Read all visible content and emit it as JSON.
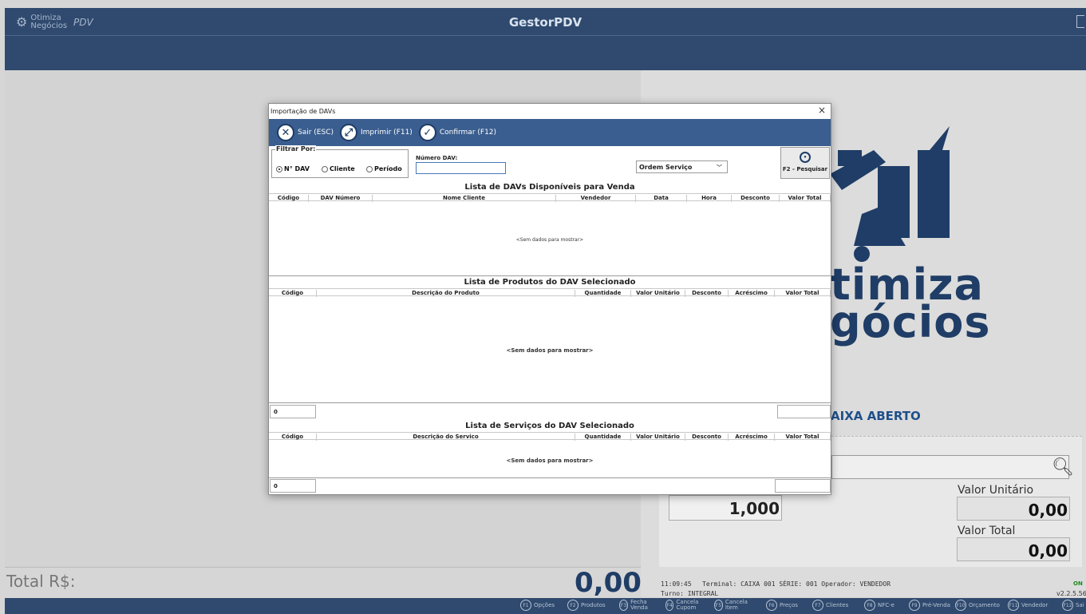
{
  "app": {
    "title": "GestorPDV",
    "logo_line1": "Otimiza",
    "logo_line2": "Negócios",
    "logo_pdv": "PDV"
  },
  "brand": {
    "line1": "timiza",
    "line2": "gócios"
  },
  "caixa_status": "AIXA ABERTO",
  "entry": {
    "quantity": "1,000",
    "unit_price_label": "Valor Unitário",
    "unit_price": "0,00",
    "total_label": "Valor Total",
    "total": "0,00"
  },
  "totals": {
    "label": "Total R$:",
    "value": "0,00"
  },
  "status": {
    "time": "11:09:45",
    "terminal": "Terminal: CAIXA 001  SÉRIE: 001   Operador: VENDEDOR",
    "turno": "Turno: INTEGRAL",
    "online": "ON",
    "version": "v2.2.5.56"
  },
  "fkeys": [
    {
      "key": "F1",
      "label": "Opções"
    },
    {
      "key": "F2",
      "label": "Produtos"
    },
    {
      "key": "F3",
      "label": "Fecha Venda"
    },
    {
      "key": "F4",
      "label": "Cancela Cupom"
    },
    {
      "key": "F5",
      "label": "Cancela Item"
    },
    {
      "key": "F6",
      "label": "Preços"
    },
    {
      "key": "F7",
      "label": "Clientes"
    },
    {
      "key": "F8",
      "label": "NFC-e"
    },
    {
      "key": "F9",
      "label": "Pré-Venda"
    },
    {
      "key": "F10",
      "label": "Orçamento"
    },
    {
      "key": "F11",
      "label": "Vendedor"
    },
    {
      "key": "F12",
      "label": "Sai"
    }
  ],
  "dialog": {
    "title": "Importação de DAVs",
    "close": "×",
    "toolbar": {
      "sair": "Sair (ESC)",
      "imprimir": "Imprimir (F11)",
      "confirmar": "Confirmar (F12)"
    },
    "filter": {
      "legend": "Filtrar Por:",
      "opt_dav": "N° DAV",
      "opt_cliente": "Cliente",
      "opt_periodo": "Período",
      "selected": "N° DAV"
    },
    "numero_dav_label": "Número DAV:",
    "numero_dav_value": "",
    "tipo_select": "Ordem Serviço",
    "pesquisar": "F2 - Pesquisar",
    "davs": {
      "title": "Lista de DAVs Disponíveis para Venda",
      "columns": [
        "Código",
        "DAV Número",
        "Nome Cliente",
        "Vendedor",
        "Data",
        "Hora",
        "Desconto",
        "Valor Total"
      ],
      "empty": "<Sem dados para mostrar>"
    },
    "produtos": {
      "title": "Lista de Produtos do DAV Selecionado",
      "columns": [
        "Código",
        "Descrição do Produto",
        "Quantidade",
        "Valor Unitário",
        "Desconto",
        "Acréscimo",
        "Valor Total"
      ],
      "empty": "<Sem dados para mostrar>",
      "count": "0",
      "total": ""
    },
    "servicos": {
      "title": "Lista de Serviços do DAV Selecionado",
      "columns": [
        "Código",
        "Descrição do Servico",
        "Quantidade",
        "Valor Unitário",
        "Desconto",
        "Acréscimo",
        "Valor Total"
      ],
      "empty": "<Sem dados para mostrar>",
      "count": "0",
      "total": ""
    }
  },
  "colors": {
    "header_blue": "#2f4a6e",
    "toolbar_blue": "#3a5e8f",
    "brand_blue": "#1f3d66"
  }
}
